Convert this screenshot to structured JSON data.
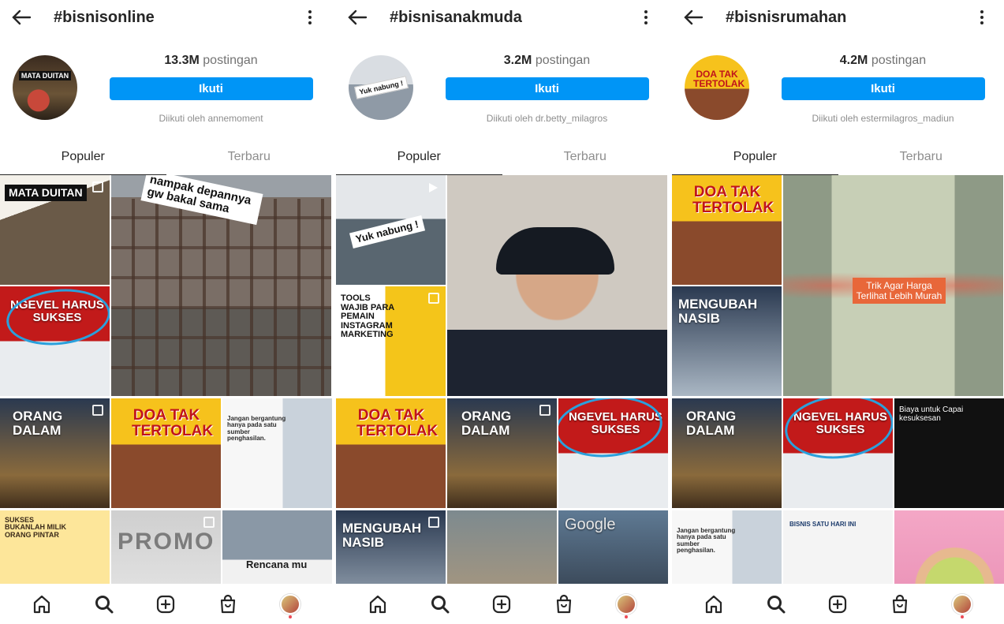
{
  "screens": [
    {
      "hashtag": "#bisnisonline",
      "post_count": "13.3M",
      "post_label": "postingan",
      "follow_label": "Ikuti",
      "followed_by": "Diikuti oleh annemoment",
      "avatar_text": "MATA DUITAN",
      "tabs": [
        "Populer",
        "Terbaru"
      ],
      "tiles": {
        "a": "MATA DUITAN",
        "b": "nampak depannya gw bakal sama",
        "c": "NGEVEL HARUS SUKSES",
        "d": "ORANG DALAM",
        "e": "DOA TAK TERTOLAK",
        "f": "Jangan bergantung hanya pada satu sumber penghasilan.",
        "g": "SUKSES BUKANLAH MILIK ORANG PINTAR",
        "h": "PROMO",
        "i": "Rencana mu"
      }
    },
    {
      "hashtag": "#bisnisanakmuda",
      "post_count": "3.2M",
      "post_label": "postingan",
      "follow_label": "Ikuti",
      "followed_by": "Diikuti oleh dr.betty_milagros",
      "avatar_text": "Yuk nabung !",
      "tabs": [
        "Populer",
        "Terbaru"
      ],
      "tiles": {
        "a": "Yuk nabung !",
        "b": "TOOLS WAJIB PARA PEMAIN INSTAGRAM MARKETING",
        "c": "",
        "d": "DOA TAK TERTOLAK",
        "e": "ORANG DALAM",
        "f": "NGEVEL HARUS SUKSES",
        "g": "MENGUBAH NASIB",
        "h": "",
        "i": "Google"
      }
    },
    {
      "hashtag": "#bisnisrumahan",
      "post_count": "4.2M",
      "post_label": "postingan",
      "follow_label": "Ikuti",
      "followed_by": "Diikuti oleh estermilagros_madiun",
      "avatar_text": "DOA TAK TERTOLAK",
      "tabs": [
        "Populer",
        "Terbaru"
      ],
      "tiles": {
        "a": "DOA TAK TERTOLAK",
        "b": "Trik Agar Harga Terlihat Lebih Murah",
        "c": "MENGUBAH NASIB",
        "d": "ORANG DALAM",
        "e": "NGEVEL HARUS SUKSES",
        "f": "Biaya untuk Capai kesuksesan",
        "g": "Jangan bergantung hanya pada satu sumber penghasilan.",
        "h": "BISNIS SATU HARI INI",
        "i": ""
      }
    }
  ],
  "nav_icons": [
    "home-icon",
    "search-icon",
    "add-icon",
    "shop-icon",
    "profile-avatar"
  ],
  "colors": {
    "follow_button": "#0095f6",
    "highlight": "#2aa0dc",
    "notification_dot": "#ed4956"
  }
}
